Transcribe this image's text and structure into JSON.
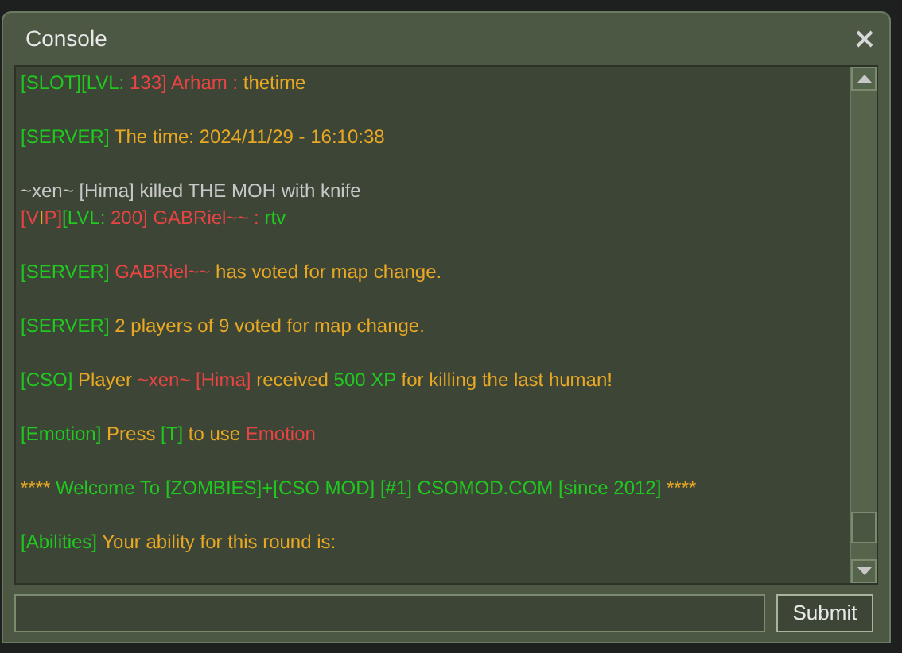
{
  "window": {
    "title": "Console"
  },
  "console": {
    "messages": [
      {
        "lines": [
          {
            "segments": [
              {
                "text": "[SLOT][LVL: ",
                "color": "#20c820"
              },
              {
                "text": "133]",
                "color": "#e84444"
              },
              {
                "text": " Arham : ",
                "color": "#e84444"
              },
              {
                "text": "thetime",
                "color": "#e8a824"
              }
            ]
          }
        ]
      },
      {
        "lines": [
          {
            "segments": [
              {
                "text": "[SERVER]",
                "color": "#20c820"
              },
              {
                "text": " The time: 2024/11/29 - 16:10:38",
                "color": "#e8a824"
              }
            ]
          }
        ]
      },
      {
        "lines": [
          {
            "segments": [
              {
                "text": "~xen~ [Hima] killed THE MOH with knife",
                "color": "#c8c8c8"
              }
            ]
          },
          {
            "segments": [
              {
                "text": "[V",
                "color": "#e84444"
              },
              {
                "text": "I",
                "color": "#e8a824"
              },
              {
                "text": "P]",
                "color": "#e84444"
              },
              {
                "text": "[LVL: ",
                "color": "#20c820"
              },
              {
                "text": "200]",
                "color": "#e84444"
              },
              {
                "text": " GABRiel~~ : ",
                "color": "#e84444"
              },
              {
                "text": "rtv",
                "color": "#20c820"
              }
            ]
          }
        ]
      },
      {
        "lines": [
          {
            "segments": [
              {
                "text": "[SERVER]",
                "color": "#20c820"
              },
              {
                "text": " GABRiel~~",
                "color": "#e84444"
              },
              {
                "text": " has voted for map change.",
                "color": "#e8a824"
              }
            ]
          }
        ]
      },
      {
        "lines": [
          {
            "segments": [
              {
                "text": "[SERVER]",
                "color": "#20c820"
              },
              {
                "text": " 2 players of 9 voted for map change.",
                "color": "#e8a824"
              }
            ]
          }
        ]
      },
      {
        "lines": [
          {
            "segments": [
              {
                "text": "[CSO]",
                "color": "#20c820"
              },
              {
                "text": " Player ",
                "color": "#e8a824"
              },
              {
                "text": "~xen~ [Hima]",
                "color": "#e84444"
              },
              {
                "text": " received ",
                "color": "#e8a824"
              },
              {
                "text": "500 XP",
                "color": "#20c820"
              },
              {
                "text": " for killing the last human!",
                "color": "#e8a824"
              }
            ]
          }
        ]
      },
      {
        "lines": [
          {
            "segments": [
              {
                "text": "[Emotion]",
                "color": "#20c820"
              },
              {
                "text": " Press ",
                "color": "#e8a824"
              },
              {
                "text": "[T]",
                "color": "#20c820"
              },
              {
                "text": " to use ",
                "color": "#e8a824"
              },
              {
                "text": "Emotion",
                "color": "#e84444"
              }
            ]
          }
        ]
      },
      {
        "lines": [
          {
            "segments": [
              {
                "text": "****",
                "color": "#e8a824"
              },
              {
                "text": " Welcome To [ZOMBIES]+[CSO MOD] [#1] CSOMOD.COM [since 2012] ",
                "color": "#20c820"
              },
              {
                "text": "****",
                "color": "#e8a824"
              }
            ]
          }
        ]
      },
      {
        "lines": [
          {
            "segments": [
              {
                "text": "[Abilities]",
                "color": "#20c820"
              },
              {
                "text": " Your ability for this round is:",
                "color": "#e8a824"
              }
            ]
          }
        ]
      }
    ]
  },
  "submit_button": "Submit"
}
